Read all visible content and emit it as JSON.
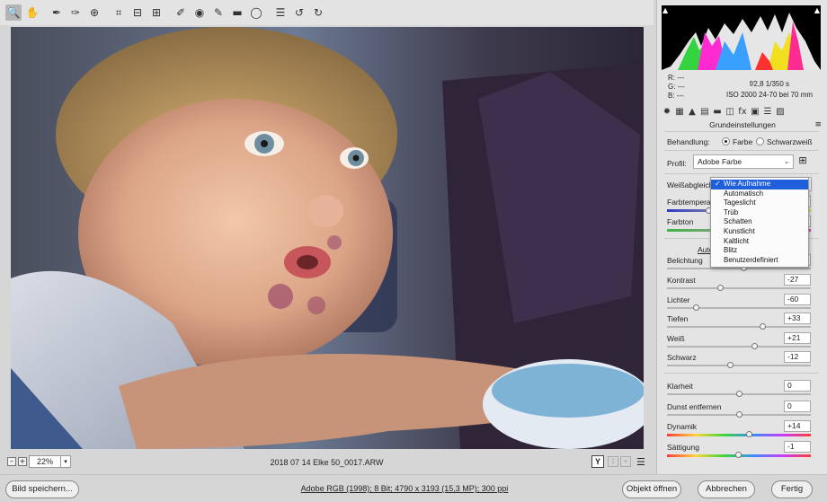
{
  "toolbar": {
    "tools": [
      {
        "icon": "zoom-icon",
        "glyph": "🔍"
      },
      {
        "icon": "hand-icon",
        "glyph": "✋"
      },
      {
        "icon": "white-balance-icon",
        "glyph": "✒"
      },
      {
        "icon": "color-sampler-icon",
        "glyph": "✑"
      },
      {
        "icon": "targeted-adjustment-icon",
        "glyph": "⊕"
      },
      {
        "icon": "crop-icon",
        "glyph": "⌗"
      },
      {
        "icon": "straighten-icon",
        "glyph": "⊟"
      },
      {
        "icon": "transform-icon",
        "glyph": "⊞"
      },
      {
        "icon": "spot-removal-icon",
        "glyph": "✐"
      },
      {
        "icon": "red-eye-icon",
        "glyph": "◉"
      },
      {
        "icon": "adjustment-brush-icon",
        "glyph": "✎"
      },
      {
        "icon": "graduated-filter-icon",
        "glyph": "▬"
      },
      {
        "icon": "radial-filter-icon",
        "glyph": "◯"
      },
      {
        "icon": "preferences-icon",
        "glyph": "☰"
      },
      {
        "icon": "rotate-left-icon",
        "glyph": "↺"
      },
      {
        "icon": "rotate-right-icon",
        "glyph": "↻"
      }
    ],
    "fullscreen_glyph": "⇲"
  },
  "status": {
    "zoom_minus": "–",
    "zoom_plus": "+",
    "zoom_value": "22%",
    "zoom_arrow": "▾",
    "filename": "2018 07 14 Elke 50_0017.ARW",
    "y_label": "Y",
    "compare_1": "‡",
    "compare_2": "+",
    "sliders_glyph": "☰"
  },
  "bottom": {
    "save_label": "Bild speichern...",
    "workflow_label": "Adobe RGB (1998); 8 Bit; 4790 x 3193 (15,3 MP); 300 ppi",
    "open_object_label": "Objekt öffnen",
    "cancel_label": "Abbrechen",
    "done_label": "Fertig"
  },
  "histogram": {
    "clip_left": "▲",
    "clip_right": "▲"
  },
  "readout": {
    "r": "R:   ---",
    "g": "G:   ---",
    "b": "B:   ---",
    "line1": "f/2,8   1/350 s",
    "line2": "ISO 2000   24-70 bei 70 mm"
  },
  "panel": {
    "tab_glyphs": [
      "✹",
      "▦",
      "▲",
      "▤",
      "▬",
      "◫",
      "fx",
      "▣",
      "☰",
      "▨"
    ],
    "section_title": "Grundeinstellungen",
    "menu_glyph": "≡",
    "treatment_label": "Behandlung:",
    "color_label": "Farbe",
    "bw_label": "Schwarzweiß",
    "profile_label": "Profil:",
    "profile_value": "Adobe Farbe",
    "profile_chev": "⌄",
    "grid_glyph": "⊞",
    "wb_label": "Weißabgleich",
    "temp_label": "Farbtemperatur",
    "tint_label": "Farbton",
    "auto_label": "Auto",
    "exposure_label": "Belichtung",
    "sliders": [
      {
        "label": "Kontrast",
        "value": "-27",
        "pos": 0.37
      },
      {
        "label": "Lichter",
        "value": "-60",
        "pos": 0.2
      },
      {
        "label": "Tiefen",
        "value": "+33",
        "pos": 0.665
      },
      {
        "label": "Weiß",
        "value": "+21",
        "pos": 0.605
      },
      {
        "label": "Schwarz",
        "value": "-12",
        "pos": 0.44
      }
    ],
    "sliders2": [
      {
        "label": "Klarheit",
        "value": "0",
        "pos": 0.5
      },
      {
        "label": "Dunst entfernen",
        "value": "0",
        "pos": 0.5
      },
      {
        "label": "Dynamik",
        "value": "+14",
        "pos": 0.57
      },
      {
        "label": "Sättigung",
        "value": "-1",
        "pos": 0.495
      }
    ]
  },
  "wb_menu": {
    "check": "✓",
    "items": [
      "Wie Aufnahme",
      "Automatisch",
      "Tageslicht",
      "Trüb",
      "Schatten",
      "Kunstlicht",
      "Kaltlicht",
      "Blitz",
      "Benutzerdefiniert"
    ],
    "selected": 0
  }
}
